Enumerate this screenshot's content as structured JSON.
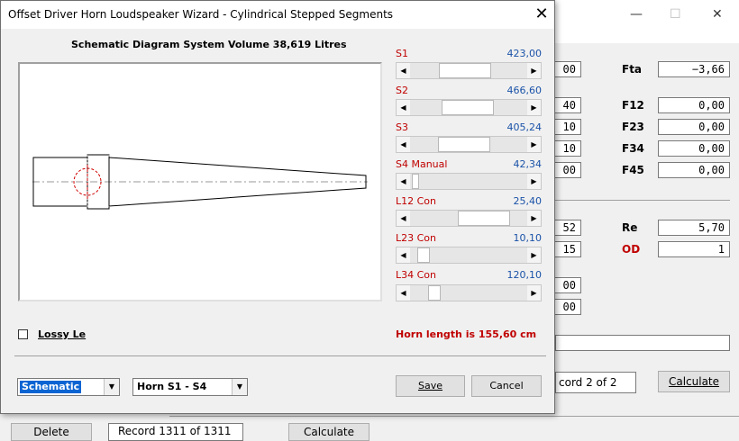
{
  "dialog": {
    "title": "Offset Driver Horn Loudspeaker Wizard - Cylindrical Stepped Segments",
    "close_glyph": "✕",
    "schematic_header": "Schematic Diagram   System Volume 38,619 Litres",
    "sliders": [
      {
        "label": "S1",
        "value": "423,00",
        "position": 0.45
      },
      {
        "label": "S2",
        "value": "466,60",
        "position": 0.49
      },
      {
        "label": "S3",
        "value": "405,24",
        "position": 0.43
      },
      {
        "label": "S4  Manual",
        "value": "42,34",
        "position": 0.02
      },
      {
        "label": "L12  Con",
        "value": "25,40",
        "position": 0.74
      },
      {
        "label": "L23  Con",
        "value": "10,10",
        "position": 0.07
      },
      {
        "label": "L34  Con",
        "value": "120,10",
        "position": 0.17
      }
    ],
    "lossy_label": "Lossy Le",
    "lossy_checked": false,
    "horn_length": "Horn length is 155,60 cm",
    "view_combo": "Schematic",
    "mode_combo": "Horn S1 - S4",
    "save_label": "Save",
    "cancel_label": "Cancel",
    "colors": {
      "accent_red": "#c00000",
      "value_blue": "#1a52a8",
      "selection": "#0a64d2"
    }
  },
  "background": {
    "title_controls": {
      "minimize": "—",
      "maximize": "☐",
      "close": "✕"
    },
    "fields_left": [
      "00",
      "40",
      "10",
      "10",
      "00",
      "52",
      "15",
      "00",
      "00"
    ],
    "labels": [
      "Fta",
      "F12",
      "F23",
      "F34",
      "F45",
      "Re",
      "OD"
    ],
    "fields_right": [
      "−3,66",
      "0,00",
      "0,00",
      "0,00",
      "0,00",
      "5,70",
      "1"
    ],
    "record_text": "cord 2 of 2",
    "calculate_label": "Calculate",
    "bottom_left_button": "Delete",
    "bottom_record": "Record 1311 of 1311",
    "bottom_right_button": "Calculate"
  }
}
